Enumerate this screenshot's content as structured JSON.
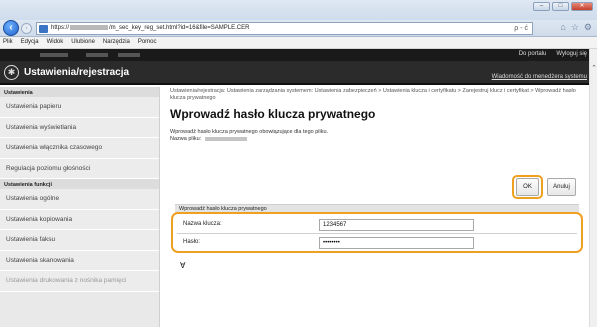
{
  "browser": {
    "url_prefix": "https://",
    "url_suffix": "/m_sec_key_reg_set.html?id=16&file=SAMPLE.CER",
    "address_tools": "ρ - ć",
    "window_buttons": [
      "–",
      "□",
      "✕"
    ],
    "menu": [
      "Plik",
      "Edycja",
      "Widok",
      "Ulubione",
      "Narzędzia",
      "Pomoc"
    ]
  },
  "header": {
    "title": "Ustawienia/rejestracja",
    "portal_link": "Do portalu",
    "logout_link": "Wyloguj się",
    "manager_link": "Wiadomość do menedżera systemu"
  },
  "sidebar": {
    "sections": [
      {
        "title": "Ustawienia",
        "items": [
          {
            "label": "Ustawienia papieru"
          },
          {
            "label": "Ustawienia wyświetlania"
          },
          {
            "label": "Ustawienia włącznika czasowego"
          },
          {
            "label": "Regulacja poziomu głośności"
          }
        ]
      },
      {
        "title": "Ustawienia funkcji",
        "items": [
          {
            "label": "Ustawienia ogólne"
          },
          {
            "label": "Ustawienia kopiowania"
          },
          {
            "label": "Ustawienia faksu"
          },
          {
            "label": "Ustawienia skanowania"
          },
          {
            "label": "Ustawienia drukowania z nośnika pamięci"
          }
        ]
      }
    ]
  },
  "main": {
    "breadcrumb": "Ustawienia/rejestracja: Ustawienia zarządzania systemem: Ustawienia zabezpieczeń > Ustawienia klucza i certyfikatu > Zarejestruj klucz i certyfikat > Wprowadź hasło klucza prywatnego",
    "title": "Wprowadź hasło klucza prywatnego",
    "description": "Wprowadź hasło klucza prywatnego obowiązujące dla tego pliku.",
    "filename_label": "Nazwa pliku:",
    "ok_label": "OK",
    "cancel_label": "Anuluj",
    "form_header": "Wprowadź hasło klucza prywatnego",
    "key_name_label": "Nazwa klucza:",
    "key_name_value": "1234567",
    "password_label": "Hasło:",
    "password_value": "••••••••",
    "back_to_top": "Ɐ"
  },
  "colors": {
    "highlight": "#f0a020",
    "header_bg": "#2b2b2b",
    "sidebar_bg": "#e9e9e9"
  }
}
